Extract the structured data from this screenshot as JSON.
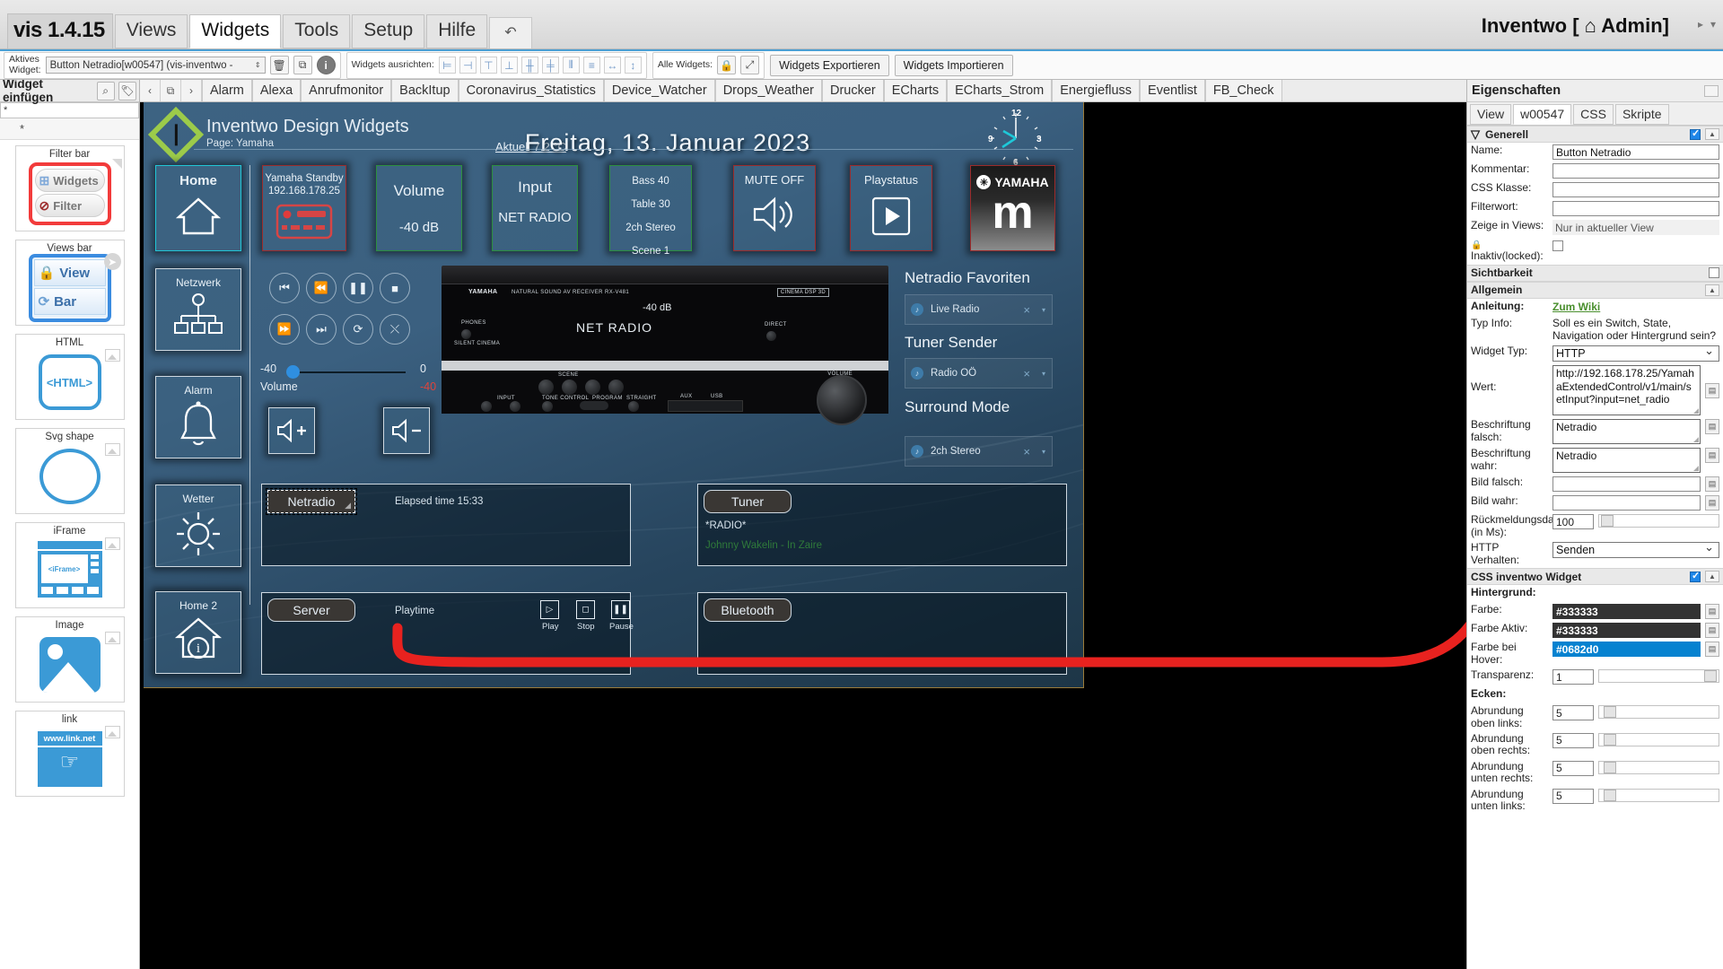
{
  "menubar": {
    "brand": "vis 1.4.15",
    "items": [
      "Views",
      "Widgets",
      "Tools",
      "Setup",
      "Hilfe"
    ],
    "active": "Widgets",
    "undo_icon": "↶",
    "user": "Inventwo [ ⌂ Admin]"
  },
  "toolbar": {
    "active_widget_label": "Aktives Widget:",
    "active_widget_value": "Button Netradio[w00547] (vis-inventwo -",
    "delete_icon": "🗑",
    "copy_icon": "⧉",
    "info_icon": "i",
    "align_label": "Widgets ausrichten:",
    "all_widgets_label": "Alle Widgets:",
    "lock_icon": "🔒",
    "expand_icon": "⤢",
    "export_label": "Widgets Exportieren",
    "import_label": "Widgets Importieren"
  },
  "left_panel": {
    "title": "Widget einfügen",
    "search_icon": "search-icon",
    "tag_icon": "tag-icon",
    "filter_value": "*",
    "star_row": "*",
    "items": [
      {
        "caption": "Filter bar",
        "pill1": "Widgets",
        "pill2": "Filter"
      },
      {
        "caption": "Views bar",
        "pill1": "View",
        "pill2": "Bar"
      },
      {
        "caption": "HTML",
        "label": "<HTML>"
      },
      {
        "caption": "Svg shape",
        "label": ""
      },
      {
        "caption": "iFrame",
        "label": "<iFrame>"
      },
      {
        "caption": "Image",
        "label": ""
      },
      {
        "caption": "link",
        "label": "www.link.net"
      }
    ]
  },
  "view_tabs": {
    "prev_icon": "‹",
    "clip_icon": "⧉",
    "next_icon": "›",
    "items": [
      "Alarm",
      "Alexa",
      "Anrufmonitor",
      "BackItup",
      "Coronavirus_Statistics",
      "Device_Watcher",
      "Drops_Weather",
      "Drucker",
      "ECharts",
      "ECharts_Strom",
      "Energiefluss",
      "Eventlist",
      "FB_Check"
    ]
  },
  "canvas": {
    "brand_title": "Inventwo Design Widgets",
    "brand_sub": "Page: Yamaha",
    "temperature": "Aktuell 7.2 °C",
    "date": "Freitag, 13. Januar 2023",
    "clock_numbers": [
      "12",
      "3",
      "6",
      "9"
    ],
    "tiles": [
      {
        "name": "home",
        "title": "Home",
        "sub": "",
        "border": "c"
      },
      {
        "name": "yamaha-standby",
        "title": "Yamaha Standby",
        "sub": "192.168.178.25",
        "border": "r"
      },
      {
        "name": "volume",
        "title": "Volume",
        "sub": "-40 dB",
        "border": "g"
      },
      {
        "name": "input",
        "title": "Input",
        "sub": "NET RADIO",
        "border": "g"
      },
      {
        "name": "bass",
        "title": "Bass 40",
        "sub": "Table 30",
        "sub2": "2ch Stereo",
        "sub3": "Scene 1",
        "border": "g"
      },
      {
        "name": "mute",
        "title": "MUTE OFF",
        "sub": "",
        "border": "r"
      },
      {
        "name": "playstatus",
        "title": "Playstatus",
        "sub": "",
        "border": "r"
      },
      {
        "name": "yamaha-musiccast",
        "title": "YAMAHA",
        "sub": "m",
        "border": "r"
      }
    ],
    "nav_tiles": [
      {
        "name": "netzwerk",
        "label": "Netzwerk"
      },
      {
        "name": "alarm",
        "label": "Alarm"
      },
      {
        "name": "wetter",
        "label": "Wetter"
      },
      {
        "name": "home2",
        "label": "Home 2"
      }
    ],
    "volume_slider": {
      "min": "-40",
      "max": "0",
      "label": "Volume",
      "value": "-40"
    },
    "receiver": {
      "brand": "YAMAHA",
      "model": "NATURAL SOUND AV RECEIVER RX-V481",
      "cinema_badge": "CINEMA DSP 3D",
      "display_db": "-40 dB",
      "display_input": "NET RADIO",
      "volume_cap": "VOLUME",
      "phones_cap": "PHONES",
      "silent_cap": "SILENT CINEMA",
      "direct_cap": "DIRECT",
      "scene_cap": "SCENE",
      "input_cap": "INPUT",
      "tone_cap": "TONE CONTROL",
      "program_cap": "PROGRAM",
      "straight_cap": "STRAIGHT",
      "aux_cap": "AUX",
      "usb_cap": "USB"
    },
    "sections": [
      {
        "heading": "Netradio Favoriten",
        "value": "Live Radio"
      },
      {
        "heading": "Tuner Sender",
        "value": "Radio OÖ"
      },
      {
        "heading": "Surround Mode",
        "value": "2ch Stereo"
      }
    ],
    "panels": {
      "netradio": {
        "button": "Netradio",
        "text": "Elapsed time 15:33"
      },
      "tuner": {
        "button": "Tuner",
        "text": "*RADIO*",
        "sub": "Johnny Wakelin - In Zaire"
      },
      "server": {
        "button": "Server",
        "text": "Playtime",
        "controls": [
          {
            "cap": "Play",
            "icon": "▷"
          },
          {
            "cap": "Stop",
            "icon": "◻"
          },
          {
            "cap": "Pause",
            "icon": "❚❚"
          }
        ]
      },
      "bluetooth": {
        "button": "Bluetooth",
        "text": ""
      }
    },
    "volume_buttons": {
      "up": "+",
      "down": "-"
    }
  },
  "right_panel": {
    "title": "Eigenschaften",
    "tabs": [
      "View",
      "w00547",
      "CSS",
      "Skripte"
    ],
    "active_tab": "w00547",
    "sections": {
      "generell": {
        "heading": "Generell",
        "filter_icon": "funnel-icon",
        "rows": [
          {
            "label": "Name:",
            "value": "Button Netradio"
          },
          {
            "label": "Kommentar:",
            "value": ""
          },
          {
            "label": "CSS Klasse:",
            "value": ""
          },
          {
            "label": "Filterwort:",
            "value": ""
          },
          {
            "label": "Zeige in Views:",
            "value": "Nur in aktueller View"
          },
          {
            "label": "Inaktiv(locked):",
            "value": ""
          }
        ]
      },
      "sichtbarkeit": {
        "heading": "Sichtbarkeit"
      },
      "allgemein": {
        "heading": "Allgemein",
        "anleitung_label": "Anleitung:",
        "anleitung_link": "Zum Wiki",
        "typinfo_label": "Typ Info:",
        "typinfo_text": "Soll es ein Switch, State, Navigation oder Hintergrund sein?",
        "widget_typ_label": "Widget Typ:",
        "widget_typ_value": "HTTP",
        "wert_label": "Wert:",
        "wert_value": "http://192.168.178.25/YamahaExtendedControl/v1/main/setInput?input=net_radio",
        "besch_falsch_label": "Beschriftung falsch:",
        "besch_falsch_value": "Netradio",
        "besch_wahr_label": "Beschriftung wahr:",
        "besch_wahr_value": "Netradio",
        "bild_falsch_label": "Bild falsch:",
        "bild_falsch_value": "",
        "bild_wahr_label": "Bild wahr:",
        "bild_wahr_value": "",
        "rueck_label": "Rückmeldungsdauer (in Ms):",
        "rueck_value": "100",
        "http_label": "HTTP Verhalten:",
        "http_value": "Senden"
      },
      "css_widget": {
        "heading": "CSS inventwo Widget",
        "hintergrund_label": "Hintergrund:",
        "farbe_label": "Farbe:",
        "farbe_value": "#333333",
        "farbe_aktiv_label": "Farbe Aktiv:",
        "farbe_aktiv_value": "#333333",
        "farbe_hover_label": "Farbe bei Hover:",
        "farbe_hover_value": "#0682d0",
        "transparenz_label": "Transparenz:",
        "transparenz_value": "1",
        "ecken_label": "Ecken:",
        "corners": [
          {
            "label": "Abrundung oben links:",
            "value": "5"
          },
          {
            "label": "Abrundung oben rechts:",
            "value": "5"
          },
          {
            "label": "Abrundung unten rechts:",
            "value": "5"
          },
          {
            "label": "Abrundung unten links:",
            "value": "5"
          }
        ]
      }
    }
  }
}
